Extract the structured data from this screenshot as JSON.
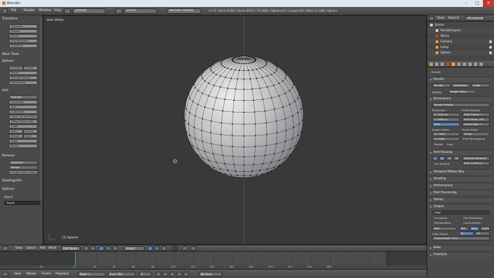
{
  "window": {
    "title": "Blender"
  },
  "info_header": {
    "menus": [
      "File",
      "Render",
      "Window",
      "Help"
    ],
    "screen_layout": "Default",
    "scene": "Scene",
    "render_engine": "Blender Render",
    "status": "v2.72 | Verts:0/482 | Faces:0/512 | Tris:960 | Objects:0/1 | Lamps:0/1 | Mem:11.34M | Sphere"
  },
  "viewport": {
    "view_label": "User Ortho",
    "object_label": "(1) Sphere"
  },
  "toolshelf": {
    "sections": {
      "transform": "Transform",
      "edit": "Edit",
      "history": "History",
      "shading": "Shading",
      "uvs": "UVs",
      "options": "Options",
      "deform": "Deform",
      "add": "Add",
      "remove": "Remove"
    },
    "transform_buttons": [
      "Translate",
      "Rotate",
      "Scale",
      "Shrink/Fatten",
      "Push/Pull"
    ],
    "edit_buttons": [
      "Duplicate",
      "Extrude",
      "Subdivide",
      "Loop Cut and Slide",
      "Offset Edge Slide",
      "Knife",
      "Select",
      "Bevel",
      "Inset",
      "Bridge Edge Loops",
      "Spin",
      "Screw",
      "Merge",
      "Split",
      "Separate"
    ],
    "shading_buttons": [
      "Smooth",
      "Flat"
    ],
    "deform_buttons": [
      "Smooth Vertex",
      "Randomize"
    ],
    "extra_sections": [
      "Mesh Tools",
      "Shading/UVs",
      "Options"
    ],
    "select_mode_label": "Select",
    "select_mode_value": "Toggle"
  },
  "view_header": {
    "menus": [
      "View",
      "Select",
      "Add",
      "Mesh"
    ],
    "mode": "Edit Mode",
    "pivot": "Global",
    "snap": "No Sync"
  },
  "timeline": {
    "frame_numbers": [
      "-20",
      "0",
      "20",
      "40",
      "60",
      "80",
      "100",
      "120",
      "140",
      "160",
      "180",
      "200",
      "220",
      "240",
      "260"
    ],
    "header_menus": [
      "View",
      "Marker",
      "Frame",
      "Playback"
    ],
    "start_label": "Start: 1",
    "end_label": "End: 250",
    "current_frame": "1",
    "sync": "No Sync"
  },
  "outliner": {
    "header_menus": [
      "View",
      "Search"
    ],
    "header_dropdown": "All Scenes",
    "items": [
      {
        "label": "Scene",
        "icon_color": "#d0d0d0"
      },
      {
        "label": "RenderLayers",
        "icon_color": "#cfcfcf"
      },
      {
        "label": "World",
        "icon_color": "#b8482b"
      },
      {
        "label": "Camera",
        "icon_color": "#f0a040"
      },
      {
        "label": "Lamp",
        "icon_color": "#f0a040"
      },
      {
        "label": "Sphere",
        "icon_color": "#f0a040"
      }
    ]
  },
  "properties": {
    "render_label": "Render",
    "render_buttons": [
      "Render",
      "Animation",
      "Audio"
    ],
    "display_label": "Display",
    "display_value": "Image Editor",
    "dimensions": {
      "title": "Dimensions",
      "preset": "Render Presets",
      "resolution_label": "Resolution:",
      "res_x": "X: 1920 px",
      "res_y": "Y: 1080 px",
      "res_pct": "50%",
      "frame_range_label": "Frame Range:",
      "start_frame": "Start Frame: 1",
      "end_frame": "End Frame: 250",
      "frame_step": "Frame Step: 1",
      "aspect_label": "Aspect Ratio:",
      "aspect_x": "X: 1.000",
      "aspect_y": "Y: 1.000",
      "frame_rate_label": "Frame Rate:",
      "frame_rate": "24 fps",
      "time_remap_label": "Time Remapping:",
      "border": "Border",
      "crop": "Crop"
    },
    "anti_aliasing": {
      "title": "Anti-Aliasing",
      "samples": [
        "5",
        "8",
        "11",
        "16"
      ],
      "filter": "Mitchell-Netravali",
      "full_sample": "Full Sample",
      "size": "Size: 1.000 px"
    },
    "collapsed_panels": [
      "Sampled Motion Blur",
      "Shading",
      "Performance",
      "Post Processing",
      "Stamp"
    ],
    "output": {
      "title": "Output",
      "path": "/tmp/",
      "overwrite": "Overwrite",
      "file_extensions": "File Extensions",
      "placeholders": "Placeholders",
      "cache_result": "Cache Result",
      "format": "PNG",
      "color_modes": [
        "BW",
        "RGB",
        "RGBA"
      ],
      "color_depth": "Color Depth",
      "depth_values": [
        "8",
        "16"
      ],
      "compression": "Compression: 15%"
    },
    "bottom_panels": [
      "Bake",
      "Freestyle"
    ]
  }
}
